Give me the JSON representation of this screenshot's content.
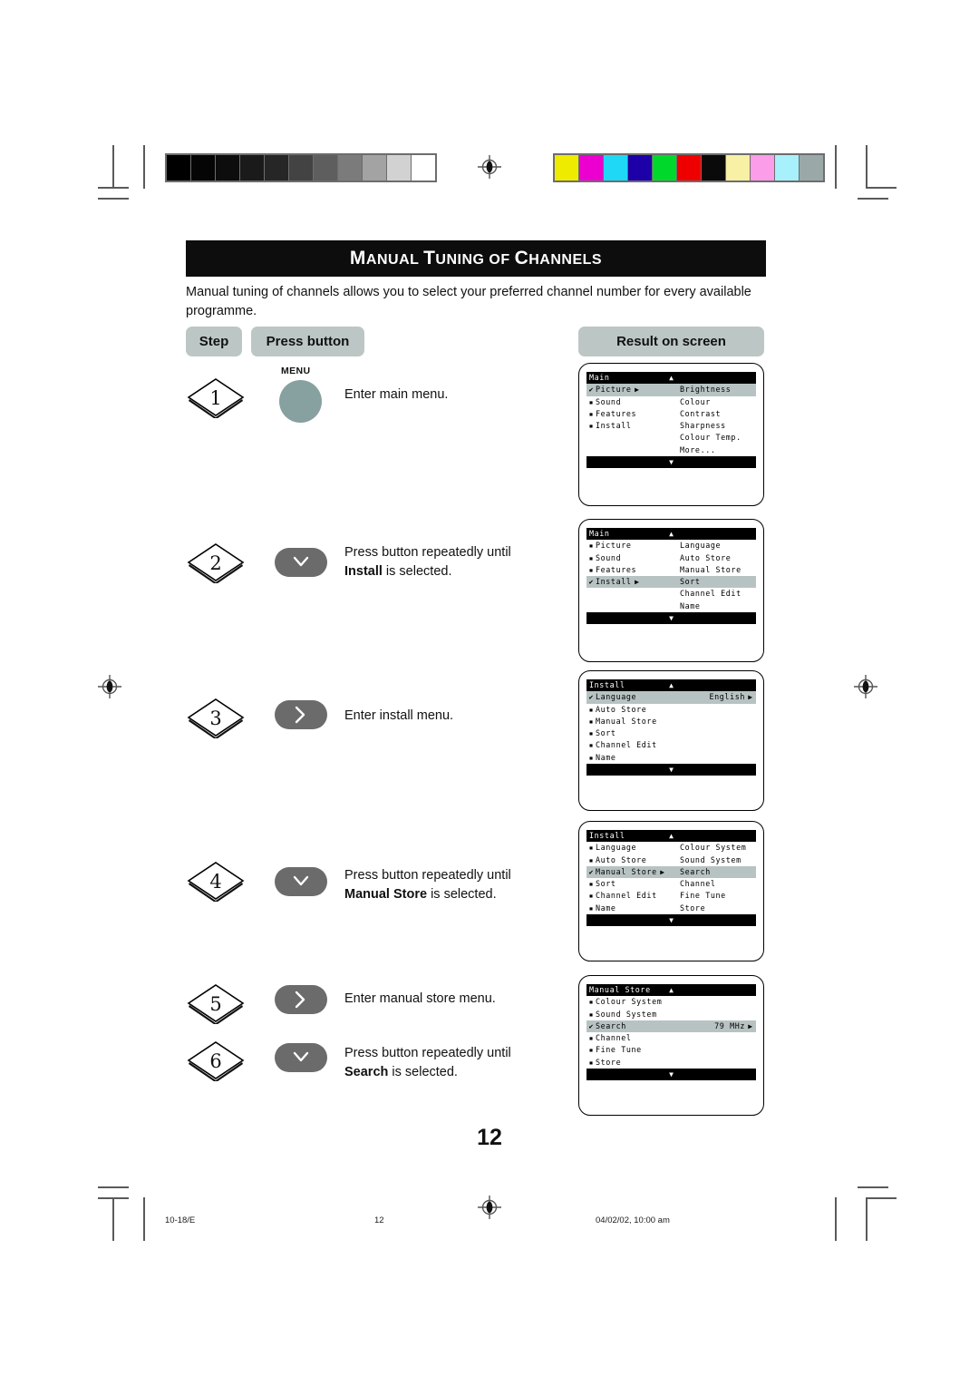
{
  "page": {
    "title_main": "ANUAL",
    "title": "Manual Tuning of Channels",
    "title_parts": [
      "M",
      "ANUAL ",
      "T",
      "UNING OF ",
      "C",
      "HANNELS"
    ],
    "intro": "Manual tuning of channels allows you to select your preferred channel number for every available programme.",
    "page_number": "12"
  },
  "headers": {
    "step": "Step",
    "press_button": "Press button",
    "result": "Result on screen"
  },
  "steps": [
    {
      "number": "1",
      "button": {
        "type": "menu",
        "label": "MENU"
      },
      "text_plain": "Enter main menu.",
      "text_prefix": "Enter main menu.",
      "text_bold": "",
      "text_suffix": ""
    },
    {
      "number": "2",
      "button": {
        "type": "down",
        "label": "down-arrow"
      },
      "text_prefix": "Press button repeatedly until",
      "text_bold": "Install",
      "text_suffix": " is selected."
    },
    {
      "number": "3",
      "button": {
        "type": "right",
        "label": "right-arrow"
      },
      "text_prefix": "Enter install menu.",
      "text_bold": "",
      "text_suffix": ""
    },
    {
      "number": "4",
      "button": {
        "type": "down",
        "label": "down-arrow"
      },
      "text_prefix": "Press button repeatedly until",
      "text_bold": "Manual Store",
      "text_suffix": " is selected."
    },
    {
      "number": "5",
      "button": {
        "type": "right",
        "label": "right-arrow"
      },
      "text_prefix": "Enter manual store menu.",
      "text_bold": "",
      "text_suffix": ""
    },
    {
      "number": "6",
      "button": {
        "type": "down",
        "label": "down-arrow"
      },
      "text_prefix": "Press button repeatedly until",
      "text_bold": "Search",
      "text_suffix": " is selected."
    }
  ],
  "screens": [
    {
      "header": "Main",
      "up_arrow": "▲",
      "down_arrow": "▼",
      "left_items": [
        {
          "label": "Picture",
          "selected": true,
          "arrow": "▶",
          "bullet": "✔"
        },
        {
          "label": "Sound",
          "selected": false,
          "arrow": "",
          "bullet": "▪"
        },
        {
          "label": "Features",
          "selected": false,
          "arrow": "",
          "bullet": "▪"
        },
        {
          "label": "Install",
          "selected": false,
          "arrow": "",
          "bullet": "▪"
        }
      ],
      "right_items": [
        "Brightness",
        "Colour",
        "Contrast",
        "Sharpness",
        "Colour Temp.",
        "More..."
      ]
    },
    {
      "header": "Main",
      "up_arrow": "▲",
      "down_arrow": "▼",
      "left_items": [
        {
          "label": "Picture",
          "selected": false,
          "arrow": "",
          "bullet": "▪"
        },
        {
          "label": "Sound",
          "selected": false,
          "arrow": "",
          "bullet": "▪"
        },
        {
          "label": "Features",
          "selected": false,
          "arrow": "",
          "bullet": "▪"
        },
        {
          "label": "Install",
          "selected": true,
          "arrow": "▶",
          "bullet": "✔"
        }
      ],
      "right_items": [
        "Language",
        "Auto Store",
        "Manual Store",
        "Sort",
        "Channel Edit",
        "Name"
      ]
    },
    {
      "header": "Install",
      "up_arrow": "▲",
      "down_arrow": "▼",
      "left_items": [
        {
          "label": "Language",
          "selected": true,
          "arrow": "",
          "bullet": "✔",
          "value": "English",
          "value_arrow": "▶"
        },
        {
          "label": "Auto Store",
          "selected": false,
          "arrow": "",
          "bullet": "▪"
        },
        {
          "label": "Manual Store",
          "selected": false,
          "arrow": "",
          "bullet": "▪"
        },
        {
          "label": "Sort",
          "selected": false,
          "arrow": "",
          "bullet": "▪"
        },
        {
          "label": "Channel Edit",
          "selected": false,
          "arrow": "",
          "bullet": "▪"
        },
        {
          "label": "Name",
          "selected": false,
          "arrow": "",
          "bullet": "▪"
        }
      ],
      "right_items": []
    },
    {
      "header": "Install",
      "up_arrow": "▲",
      "down_arrow": "▼",
      "left_items": [
        {
          "label": "Language",
          "selected": false,
          "arrow": "",
          "bullet": "▪"
        },
        {
          "label": "Auto Store",
          "selected": false,
          "arrow": "",
          "bullet": "▪"
        },
        {
          "label": "Manual Store",
          "selected": true,
          "arrow": "▶",
          "bullet": "✔"
        },
        {
          "label": "Sort",
          "selected": false,
          "arrow": "",
          "bullet": "▪"
        },
        {
          "label": "Channel Edit",
          "selected": false,
          "arrow": "",
          "bullet": "▪"
        },
        {
          "label": "Name",
          "selected": false,
          "arrow": "",
          "bullet": "▪"
        }
      ],
      "right_items": [
        "Colour System",
        "Sound System",
        "Search",
        "Channel",
        "Fine Tune",
        "Store"
      ]
    },
    {
      "header": "Manual Store",
      "up_arrow": "▲",
      "down_arrow": "▼",
      "left_items": [
        {
          "label": "Colour System",
          "selected": false,
          "arrow": "",
          "bullet": "▪"
        },
        {
          "label": "Sound System",
          "selected": false,
          "arrow": "",
          "bullet": "▪"
        },
        {
          "label": "Search",
          "selected": true,
          "arrow": "",
          "bullet": "✔",
          "value": "79 MHz",
          "value_arrow": "▶"
        },
        {
          "label": "Channel",
          "selected": false,
          "arrow": "",
          "bullet": "▪"
        },
        {
          "label": "Fine Tune",
          "selected": false,
          "arrow": "",
          "bullet": "▪"
        },
        {
          "label": "Store",
          "selected": false,
          "arrow": "",
          "bullet": "▪"
        }
      ],
      "right_items": []
    }
  ],
  "footer": {
    "left": "10-18/E",
    "center": "12",
    "right": "04/02/02, 10:00 am"
  },
  "calibration": {
    "grayscale": [
      "#000000",
      "#050505",
      "#0d0d0d",
      "#1a1a1a",
      "#262626",
      "#434343",
      "#5e5e5e",
      "#7b7b7b",
      "#a3a3a3",
      "#d2d2d2",
      "#ffffff"
    ],
    "colors": [
      "#eeea00",
      "#ec00d0",
      "#1fd8f5",
      "#1d00a8",
      "#00d92b",
      "#ef0000",
      "#0a0a0a",
      "#f7f0a5",
      "#fb9de8",
      "#a8f0fb",
      "#9aa8a8"
    ]
  },
  "colors": {
    "pill": "#bcc7c5",
    "menu_button": "#87a0a0",
    "dir_button": "#6b6b6b",
    "osd_highlight": "#b7c3c2",
    "osd_bar": "#000000"
  }
}
